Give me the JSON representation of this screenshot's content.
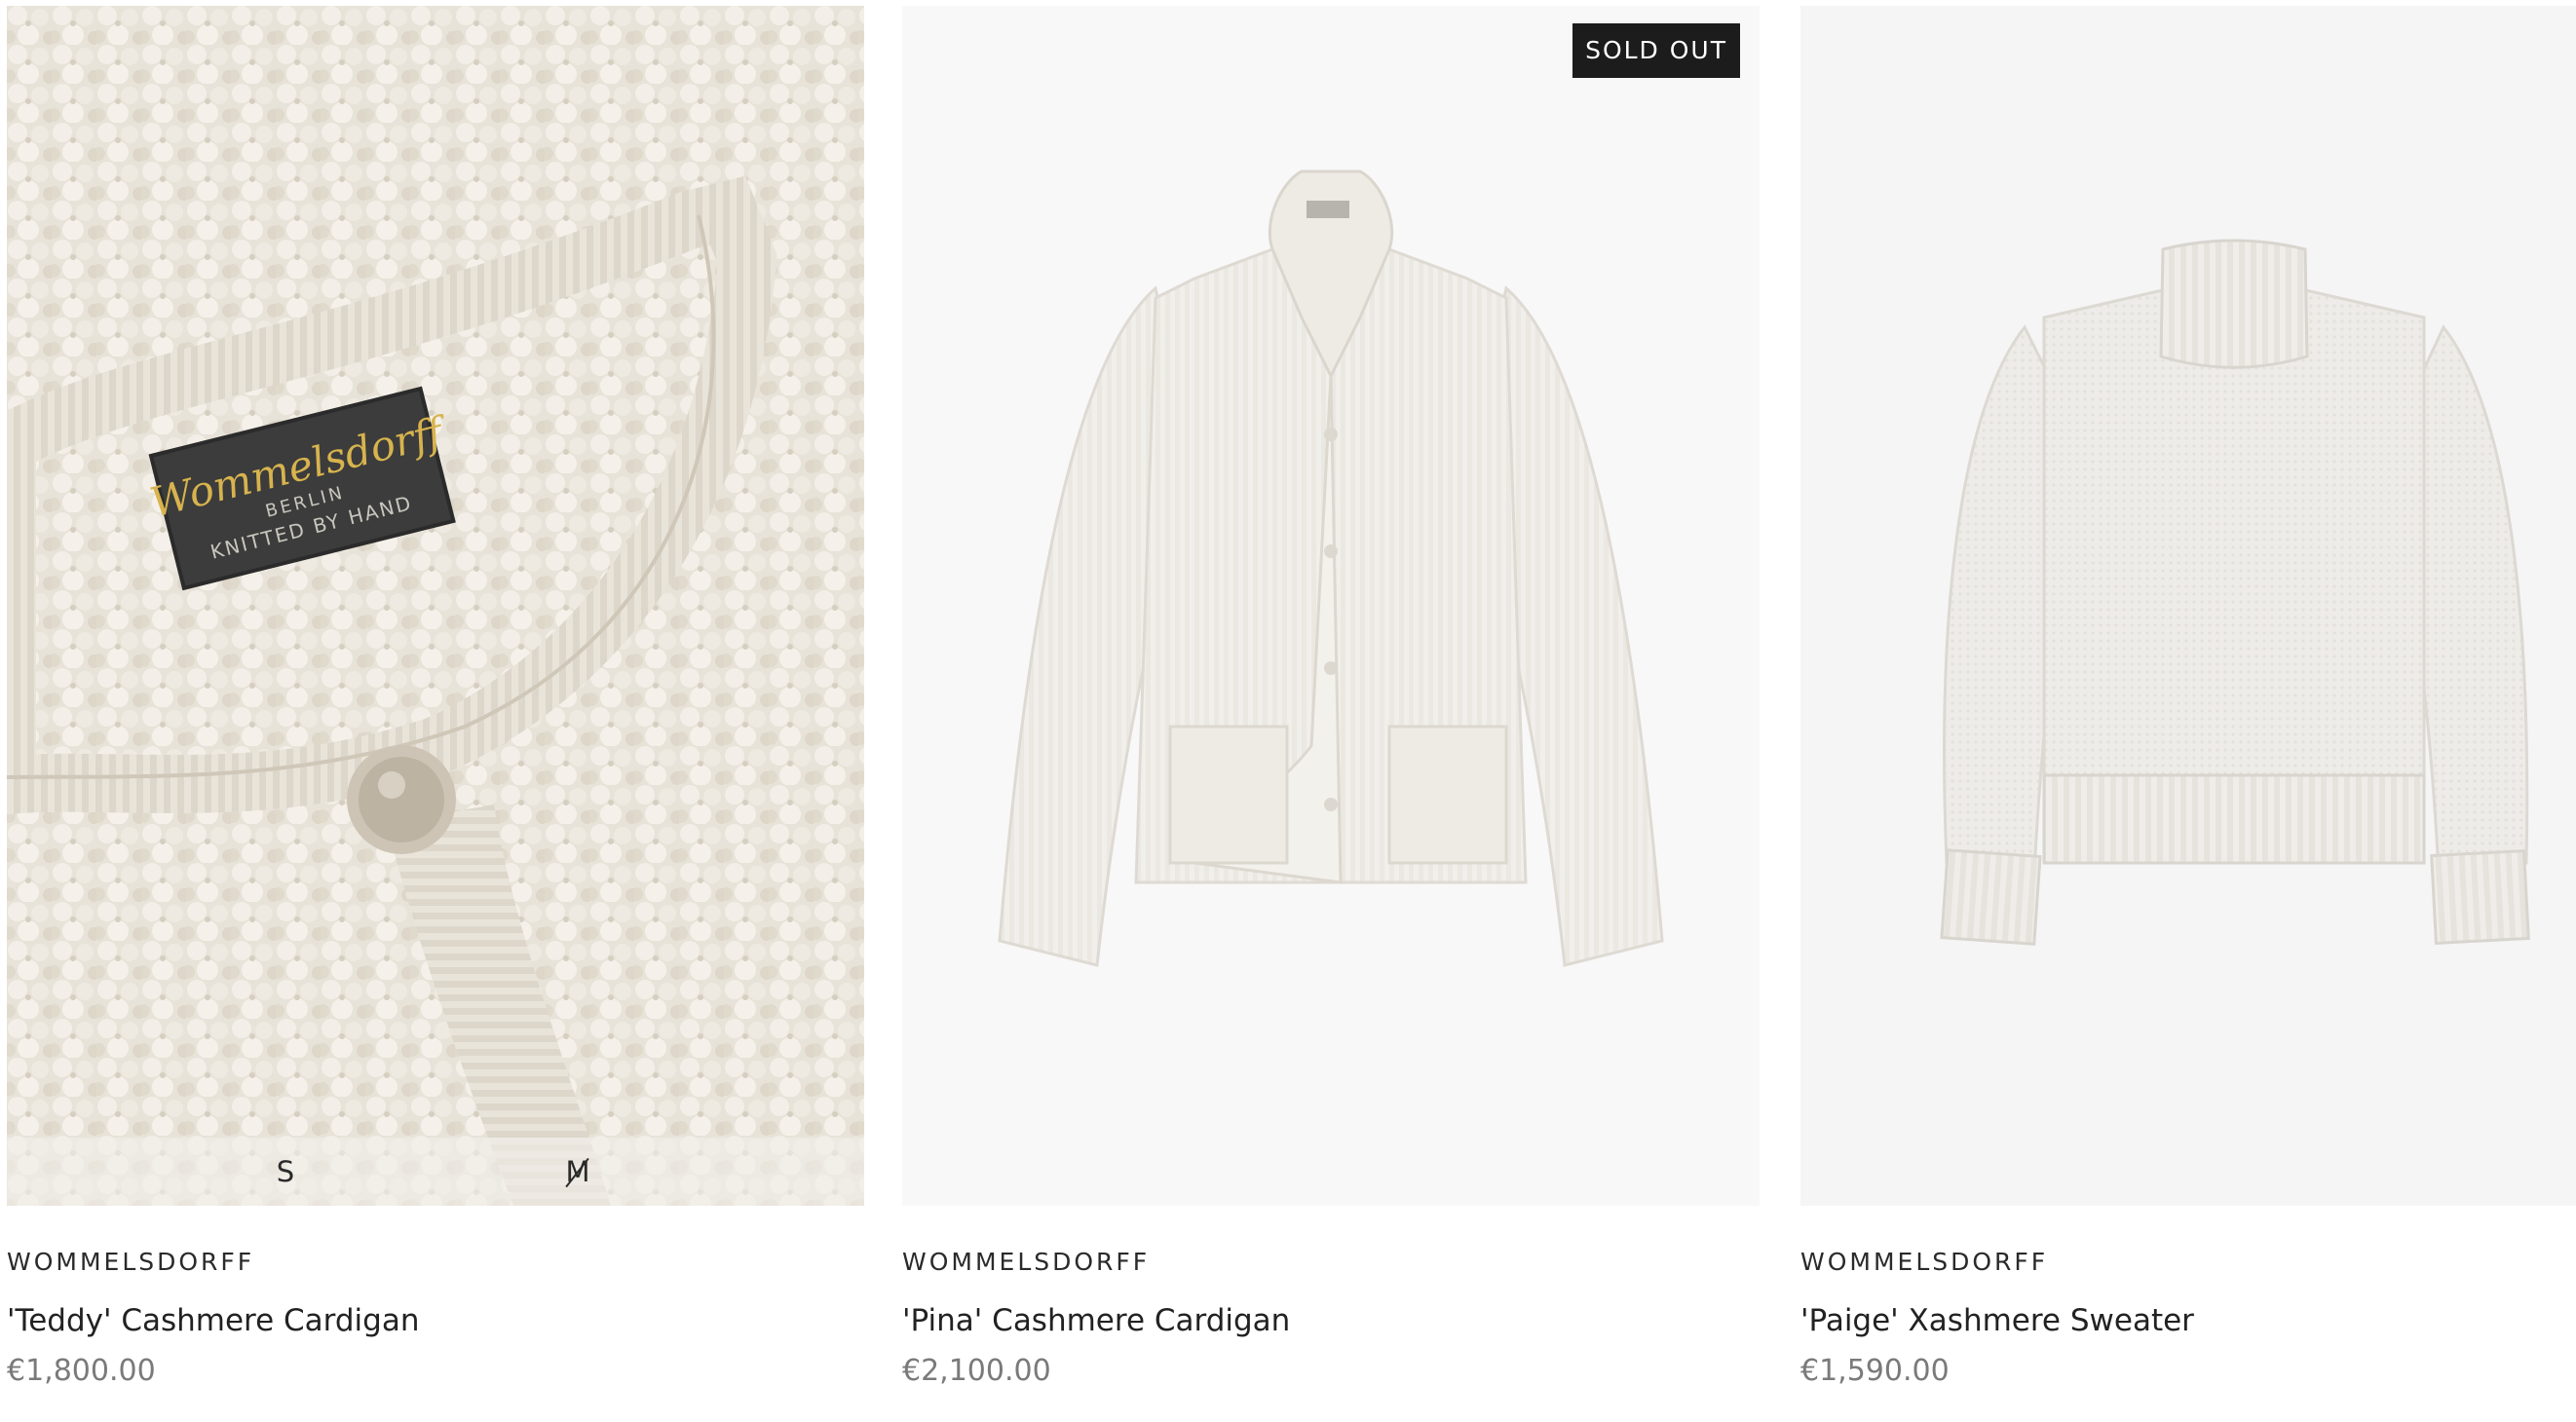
{
  "products": [
    {
      "brand": "WOMMELSDORFF",
      "title": "'Teddy' Cashmere Cardigan",
      "price": "€1,800.00",
      "label_text": [
        "Wommelsdorff",
        "BERLIN",
        "KNITTED BY HAND"
      ],
      "sizes": [
        {
          "label": "S",
          "available": true
        },
        {
          "label": "M",
          "available": false
        }
      ]
    },
    {
      "brand": "WOMMELSDORFF",
      "title": "'Pina' Cashmere Cardigan",
      "price": "€2,100.00",
      "badge": "SOLD OUT"
    },
    {
      "brand": "WOMMELSDORFF",
      "title": "'Paige' Xashmere Sweater",
      "price": "€1,590.00"
    }
  ],
  "colors": {
    "knit_cream": "#e9e4da",
    "photo_bg": "#f7f7f7",
    "badge_bg": "#1c1c1c",
    "price_text": "#7a7a7a"
  }
}
